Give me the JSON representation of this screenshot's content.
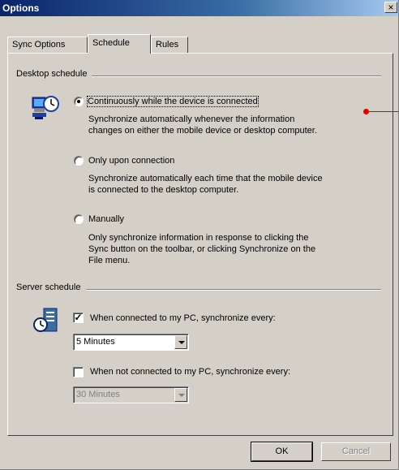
{
  "window": {
    "title": "Options",
    "close_glyph": "×"
  },
  "tabs": [
    {
      "label": "Sync Options",
      "active": false
    },
    {
      "label": "Schedule",
      "active": true
    },
    {
      "label": "Rules",
      "active": false
    }
  ],
  "desktop_schedule": {
    "heading": "Desktop schedule",
    "icon": "desktop-sync-icon",
    "options": [
      {
        "label": "Continuously while the device is connected",
        "checked": true,
        "description": [
          "Synchronize automatically whenever the information",
          "changes on either the mobile device or desktop computer."
        ]
      },
      {
        "label": "Only upon connection",
        "checked": false,
        "description": [
          "Synchronize automatically each time that the mobile device",
          "is connected to the desktop computer."
        ]
      },
      {
        "label": "Manually",
        "checked": false,
        "description": [
          "Only synchronize information in response to clicking the",
          "Sync button on the toolbar, or clicking Synchronize on the",
          "File menu."
        ]
      }
    ]
  },
  "server_schedule": {
    "heading": "Server schedule",
    "icon": "server-sync-icon",
    "connected": {
      "label": "When connected to my PC, synchronize every:",
      "checked": true,
      "interval": "5 Minutes"
    },
    "not_connected": {
      "label": "When not connected to my PC, synchronize every:",
      "checked": false,
      "interval": "30 Minutes"
    }
  },
  "buttons": {
    "ok": "OK",
    "cancel": "Cancel"
  },
  "colors": {
    "annotation": "#e00000",
    "title_bar": "#0a246a",
    "face": "#d4d0c8"
  }
}
